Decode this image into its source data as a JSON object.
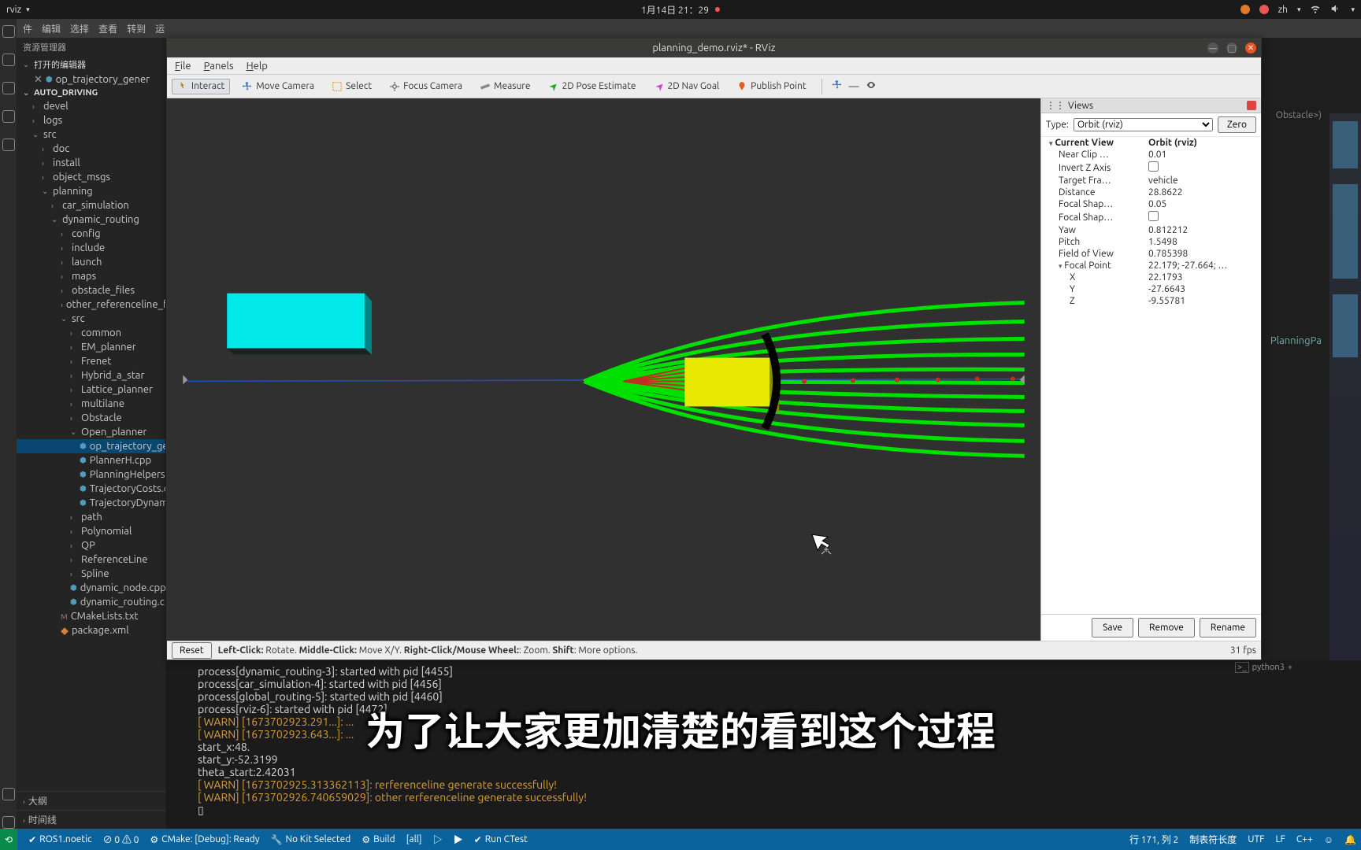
{
  "sysbar": {
    "app": "rviz",
    "clock": "1月14日 21：29",
    "lang": "zh"
  },
  "vscode_menu": [
    "件",
    "编辑",
    "选择",
    "查看",
    "转到",
    "运"
  ],
  "sidebar": {
    "title": "资源管理器",
    "open_editors": "打开的编辑器",
    "open_file": "op_trajectory_gener",
    "project": "AUTO_DRIVING",
    "tree": [
      {
        "l": 1,
        "t": "fld",
        "n": "devel",
        "e": "›"
      },
      {
        "l": 1,
        "t": "fld",
        "n": "logs",
        "e": "›"
      },
      {
        "l": 1,
        "t": "fld",
        "n": "src",
        "e": "⌄"
      },
      {
        "l": 2,
        "t": "fld",
        "n": "doc",
        "e": "›"
      },
      {
        "l": 2,
        "t": "fld",
        "n": "install",
        "e": "›"
      },
      {
        "l": 2,
        "t": "fld",
        "n": "object_msgs",
        "e": "›"
      },
      {
        "l": 2,
        "t": "fld",
        "n": "planning",
        "e": "⌄"
      },
      {
        "l": 3,
        "t": "fld",
        "n": "car_simulation",
        "e": "›"
      },
      {
        "l": 3,
        "t": "fld",
        "n": "dynamic_routing",
        "e": "⌄"
      },
      {
        "l": 4,
        "t": "fld",
        "n": "config",
        "e": "›"
      },
      {
        "l": 4,
        "t": "fld",
        "n": "include",
        "e": "›"
      },
      {
        "l": 4,
        "t": "fld",
        "n": "launch",
        "e": "›"
      },
      {
        "l": 4,
        "t": "fld",
        "n": "maps",
        "e": "›"
      },
      {
        "l": 4,
        "t": "fld",
        "n": "obstacle_files",
        "e": "›"
      },
      {
        "l": 4,
        "t": "fld",
        "n": "other_referenceline_f",
        "e": "›"
      },
      {
        "l": 4,
        "t": "fld",
        "n": "src",
        "e": "⌄"
      },
      {
        "l": 5,
        "t": "fld",
        "n": "common",
        "e": "›"
      },
      {
        "l": 5,
        "t": "fld",
        "n": "EM_planner",
        "e": "›"
      },
      {
        "l": 5,
        "t": "fld",
        "n": "Frenet",
        "e": "›"
      },
      {
        "l": 5,
        "t": "fld",
        "n": "Hybrid_a_star",
        "e": "›"
      },
      {
        "l": 5,
        "t": "fld",
        "n": "Lattice_planner",
        "e": "›"
      },
      {
        "l": 5,
        "t": "fld",
        "n": "multilane",
        "e": "›"
      },
      {
        "l": 5,
        "t": "fld",
        "n": "Obstacle",
        "e": "›"
      },
      {
        "l": 5,
        "t": "fld",
        "n": "Open_planner",
        "e": "⌄"
      },
      {
        "l": 6,
        "t": "cpp",
        "n": "op_trajectory_gen",
        "sel": true
      },
      {
        "l": 6,
        "t": "cpp",
        "n": "PlannerH.cpp"
      },
      {
        "l": 6,
        "t": "cpp",
        "n": "PlanningHelpers.cp"
      },
      {
        "l": 6,
        "t": "cpp",
        "n": "TrajectoryCosts.cpp"
      },
      {
        "l": 6,
        "t": "cpp",
        "n": "TrajectoryDynamicCosts.cpp"
      },
      {
        "l": 5,
        "t": "fld",
        "n": "path",
        "e": "›"
      },
      {
        "l": 5,
        "t": "fld",
        "n": "Polynomial",
        "e": "›"
      },
      {
        "l": 5,
        "t": "fld",
        "n": "QP",
        "e": "›"
      },
      {
        "l": 5,
        "t": "fld",
        "n": "ReferenceLine",
        "e": "›"
      },
      {
        "l": 5,
        "t": "fld",
        "n": "Spline",
        "e": "›"
      },
      {
        "l": 5,
        "t": "cpp",
        "n": "dynamic_node.cpp"
      },
      {
        "l": 5,
        "t": "cpp",
        "n": "dynamic_routing.cpp"
      },
      {
        "l": 4,
        "t": "cmk",
        "n": "CMakeLists.txt"
      },
      {
        "l": 4,
        "t": "xml",
        "n": "package.xml"
      }
    ],
    "outline": "大纲",
    "timeline": "时间线"
  },
  "rviz": {
    "title": "planning_demo.rviz* - RViz",
    "menu": [
      "File",
      "Panels",
      "Help"
    ],
    "toolbar": [
      {
        "icon": "interact",
        "label": "Interact",
        "active": true
      },
      {
        "icon": "move",
        "label": "Move Camera"
      },
      {
        "icon": "select",
        "label": "Select"
      },
      {
        "icon": "focus",
        "label": "Focus Camera"
      },
      {
        "icon": "measure",
        "label": "Measure"
      },
      {
        "icon": "pose",
        "label": "2D Pose Estimate"
      },
      {
        "icon": "nav",
        "label": "2D Nav Goal"
      },
      {
        "icon": "pub",
        "label": "Publish Point"
      }
    ],
    "views": {
      "panel": "Views",
      "type_label": "Type:",
      "type_value": "Orbit (rviz)",
      "zero": "Zero",
      "rows": [
        {
          "k": "Current View",
          "v": "Orbit (rviz)",
          "b": true,
          "e": "▾"
        },
        {
          "k": "Near Clip …",
          "v": "0.01"
        },
        {
          "k": "Invert Z Axis",
          "v": "",
          "cb": true
        },
        {
          "k": "Target Fra…",
          "v": "vehicle"
        },
        {
          "k": "Distance",
          "v": "28.8622"
        },
        {
          "k": "Focal Shap…",
          "v": "0.05"
        },
        {
          "k": "Focal Shap…",
          "v": "",
          "cb": true
        },
        {
          "k": "Yaw",
          "v": "0.812212"
        },
        {
          "k": "Pitch",
          "v": "1.5498"
        },
        {
          "k": "Field of View",
          "v": "0.785398"
        },
        {
          "k": "Focal Point",
          "v": "22.179; -27.664; …",
          "e": "▾"
        },
        {
          "k": "X",
          "v": "22.1793",
          "i": 1
        },
        {
          "k": "Y",
          "v": "-27.6643",
          "i": 1
        },
        {
          "k": "Z",
          "v": "-9.55781",
          "i": 1
        }
      ],
      "buttons": [
        "Save",
        "Remove",
        "Rename"
      ]
    },
    "status": {
      "reset": "Reset",
      "help": "Left-Click: Rotate. Middle-Click: Move X/Y. Right-Click/Mouse Wheel:: Zoom. Shift: More options.",
      "fps": "31 fps"
    }
  },
  "peek_right": "Obstacle>)",
  "peek_right2": "PlanningPa",
  "terminal": [
    {
      "c": "",
      "t": "process[dynamic_routing-3]: started with pid [4455]"
    },
    {
      "c": "",
      "t": "process[car_simulation-4]: started with pid [4456]"
    },
    {
      "c": "",
      "t": "process[global_routing-5]: started with pid [4460]"
    },
    {
      "c": "",
      "t": "process[rviz-6]: started with pid [4472]"
    },
    {
      "c": "warn",
      "t": "[ WARN] [1673702923.291...]: ..."
    },
    {
      "c": "warn",
      "t": "[ WARN] [1673702923.643...]: ..."
    },
    {
      "c": "",
      "t": "start_x:48."
    },
    {
      "c": "",
      "t": "start_y:-52.3199"
    },
    {
      "c": "",
      "t": "theta_start:2.42031"
    },
    {
      "c": "warn",
      "t": "[ WARN] [1673702925.313362113]: rerferenceline generate successfully!"
    },
    {
      "c": "warn",
      "t": "[ WARN] [1673702926.740659029]: other rerferenceline generate successfully!"
    }
  ],
  "term_tab": "python3",
  "subtitle": "为了让大家更加清楚的看到这个过程",
  "statusbar": {
    "ros": "ROS1.noetic",
    "err": "⊘ 0 ⚠ 0",
    "cmake": "CMake: [Debug]: Ready",
    "kit": "No Kit Selected",
    "build": "Build",
    "target": "[all]",
    "ctest": "Run CTest",
    "pos": "行 171, 列 2",
    "spaces": "制表符长度",
    "enc": "UTF",
    "eol": "LF",
    "lang": "C++"
  }
}
